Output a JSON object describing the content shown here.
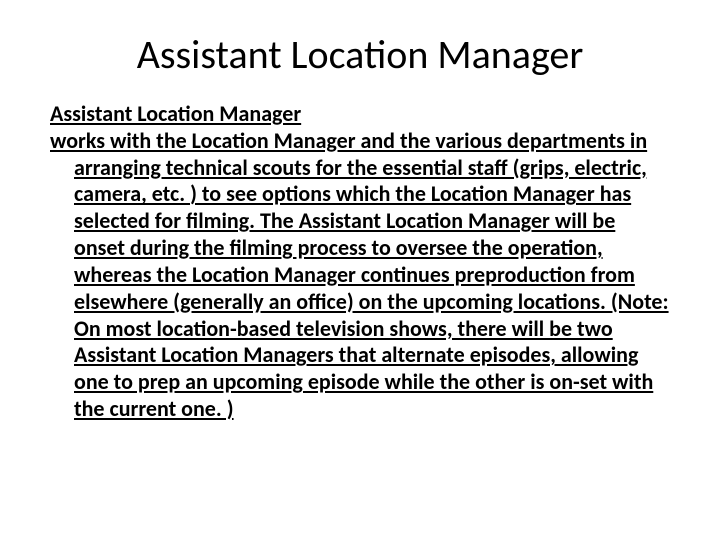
{
  "title": "Assistant Location Manager",
  "body_line1": "Assistant Location Manager",
  "body_line2": "works with the Location Manager and the various departments in arranging technical scouts for the essential staff (grips, electric, camera, etc. ) to see options which the Location Manager has selected for filming. The Assistant Location Manager will be onset during the filming process to oversee the operation, whereas the Location Manager continues preproduction from elsewhere (generally an office) on the upcoming locations. (Note: On most location-based television shows, there will be two Assistant Location Managers that alternate episodes, allowing one to prep an upcoming episode while the other is on-set with the current one. )"
}
